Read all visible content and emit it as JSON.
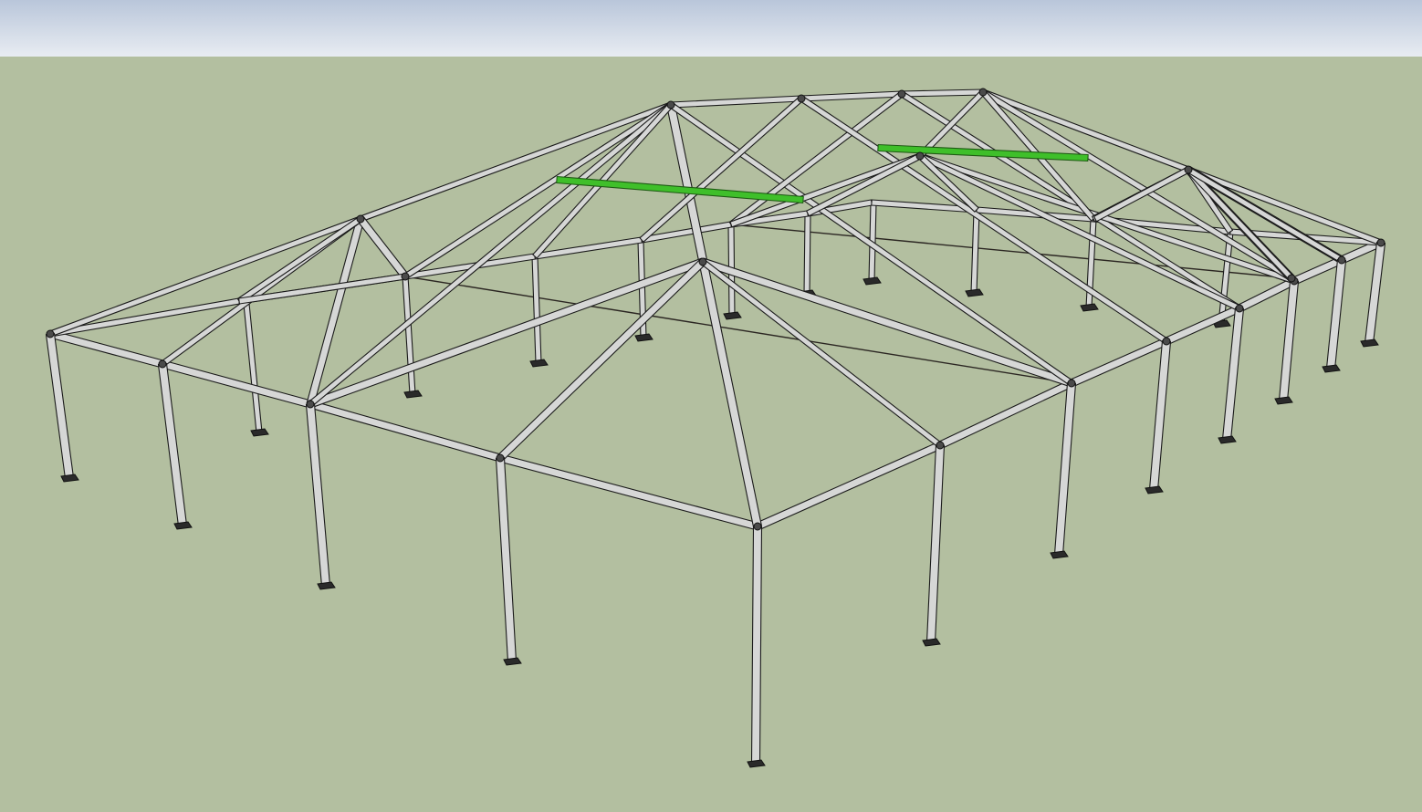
{
  "scene": {
    "sky_color_top": "#b9c6da",
    "sky_color_bottom": "#e8ecf2",
    "ground_color": "#b3bfa0",
    "pole_fill": "#d6d7d6",
    "pole_stroke": "#1a1a1a",
    "purlin_highlight_color": "#3fbf2a",
    "footplate_color": "#2a2a2a",
    "connector_color": "#4a4a4a"
  }
}
